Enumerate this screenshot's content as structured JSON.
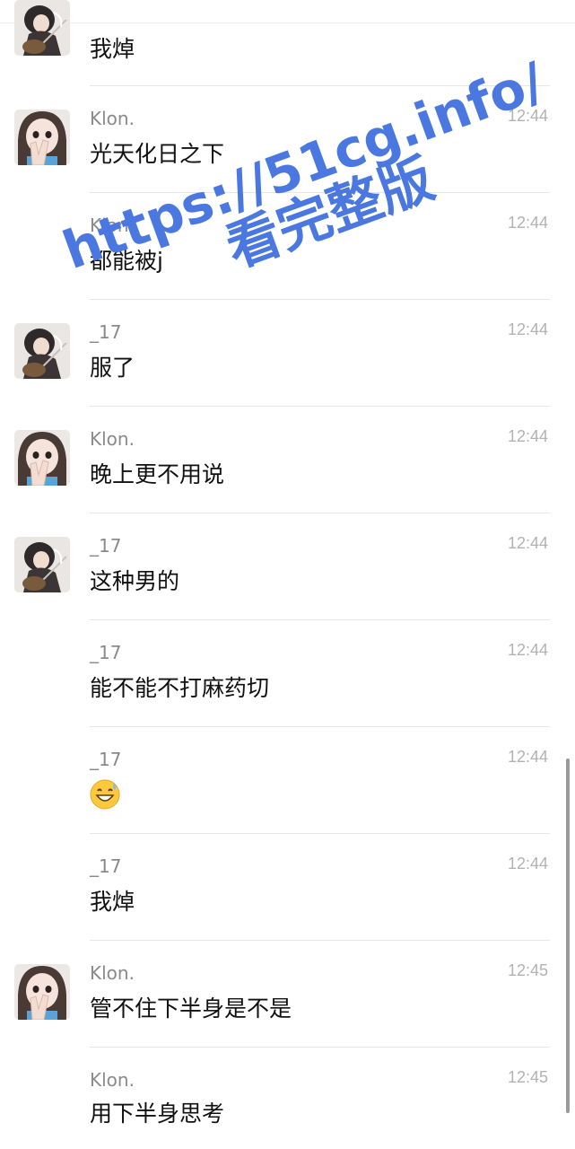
{
  "messages": [
    {
      "sender": "",
      "time": "",
      "text": "我焯",
      "avatar": "guitar-girl-avatar"
    },
    {
      "sender": "Klon.",
      "time": "12:44",
      "text": "光天化日之下",
      "avatar": "peace-sign-girl-avatar"
    },
    {
      "sender": "Klon.",
      "time": "12:44",
      "text": "都能被j",
      "avatar": ""
    },
    {
      "sender": "_17",
      "time": "12:44",
      "text": "服了",
      "avatar": "guitar-girl-avatar"
    },
    {
      "sender": "Klon.",
      "time": "12:44",
      "text": "晚上更不用说",
      "avatar": "peace-sign-girl-avatar"
    },
    {
      "sender": "_17",
      "time": "12:44",
      "text": "这种男的",
      "avatar": "guitar-girl-avatar"
    },
    {
      "sender": "_17",
      "time": "12:44",
      "text": "能不能不打麻药切",
      "avatar": ""
    },
    {
      "sender": "_17",
      "time": "12:44",
      "text": "",
      "emoji": "grinning-sweat-emoji",
      "avatar": ""
    },
    {
      "sender": "_17",
      "time": "12:44",
      "text": "我焯",
      "avatar": ""
    },
    {
      "sender": "Klon.",
      "time": "12:45",
      "text": "管不住下半身是不是",
      "avatar": "peace-sign-girl-avatar"
    },
    {
      "sender": "Klon.",
      "time": "12:45",
      "text": "用下半身思考",
      "avatar": ""
    }
  ],
  "watermark": {
    "line1": "https://51cg.info/",
    "line2": "看完整版",
    "color": "#4a78e0"
  },
  "colors": {
    "sender": "#8a8a8a",
    "time": "#b2b2b2",
    "text": "#111111",
    "divider": "#e6e6e6"
  }
}
